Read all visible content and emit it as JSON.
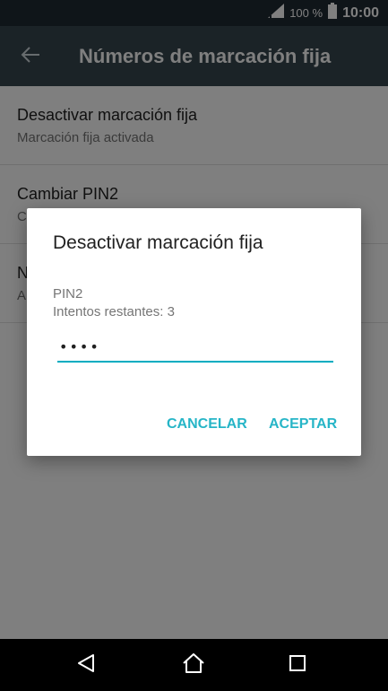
{
  "status_bar": {
    "battery_pct": "100 %",
    "time": "10:00"
  },
  "toolbar": {
    "title": "Números de marcación fija"
  },
  "list": {
    "items": [
      {
        "title": "Desactivar marcación fija",
        "subtitle": "Marcación fija activada"
      },
      {
        "title": "Cambiar PIN2",
        "subtitle": "C"
      },
      {
        "title": "N",
        "subtitle": "A"
      }
    ]
  },
  "dialog": {
    "title": "Desactivar marcación fija",
    "field_label": "PIN2",
    "attempts": "Intentos restantes: 3",
    "pin_value": "••••",
    "cancel_label": "CANCELAR",
    "ok_label": "ACEPTAR"
  },
  "colors": {
    "accent": "#26b5c7",
    "toolbar": "#37474f",
    "status_bar": "#1f2a33"
  },
  "icons": {
    "signal": "signal-icon",
    "battery": "battery-icon",
    "back_arrow": "arrow-left-icon",
    "nav_back": "triangle-back-icon",
    "nav_home": "home-icon",
    "nav_recent": "square-recent-icon"
  }
}
